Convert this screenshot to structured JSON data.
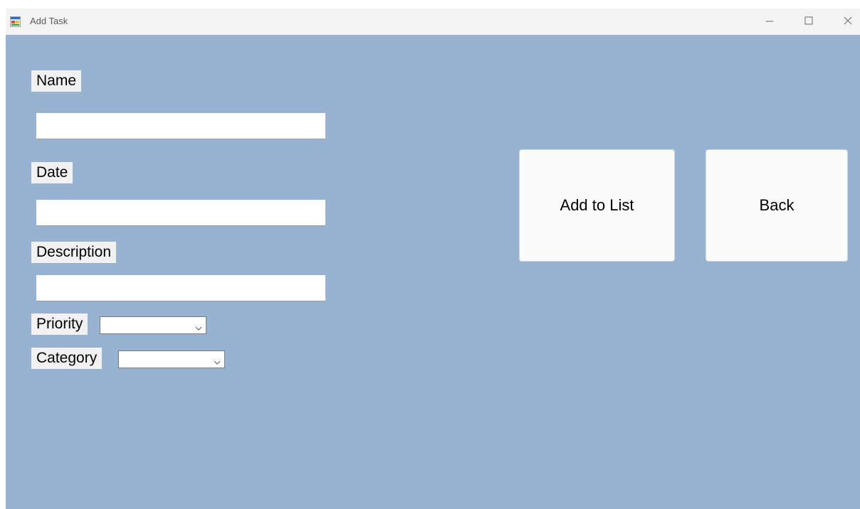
{
  "window": {
    "title": "Add Task",
    "icon": "app-form-icon",
    "controls": {
      "minimize_icon": "minimize-icon",
      "maximize_icon": "maximize-icon",
      "close_icon": "close-icon"
    }
  },
  "form": {
    "name_label": "Name",
    "name_value": "",
    "date_label": "Date",
    "date_value": "",
    "description_label": "Description",
    "description_value": "",
    "priority_label": "Priority",
    "priority_value": "",
    "category_label": "Category",
    "category_value": ""
  },
  "buttons": {
    "add_label": "Add to List",
    "back_label": "Back"
  },
  "colors": {
    "form_background": "#98b3d1",
    "titlebar_background": "#f3f3f3",
    "label_background": "#f1f1f1",
    "button_background": "#fbfbfb"
  }
}
